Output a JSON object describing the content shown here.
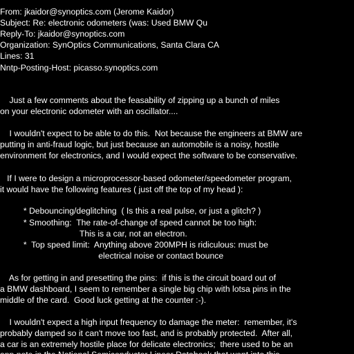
{
  "headers": {
    "from": "From: jkaidor@synoptics.com (Jerome Kaidor)",
    "subject": "Subject: Re: electronic odometers (was: Used BMW Qu",
    "reply_to": "Reply-To: jkaidor@synoptics.com",
    "organization": "Organization: SynOptics Communications, Santa Clara CA",
    "lines": "Lines: 31",
    "nntp_posting_host": "Nntp-Posting-Host: picasso.synoptics.com"
  },
  "body": {
    "p1": [
      "    Just a few comments about the feasability of zipping up a bunch of miles",
      "on your electronic odometer with an oscillator...."
    ],
    "p2": [
      "    I wouldn't expect to be able to do this.  Not because the engineers at BMW are",
      "putting in anti-fraud logic, but just because an automobile is a noisy, hostile",
      "environment for electronics, and I would expect the software to be conservative."
    ],
    "p3": [
      "   If I were to design a microprocessor-based odometer/speedometer program,",
      "it would have the following features ( just off the top of my head ):"
    ],
    "features": [
      "          * Debouncing/deglitching  ( Is this a real pulse, or just a glitch? )",
      "          * Smoothing:  The rate-of-change of speed cannot be too high:",
      "                                  This is a car, not an electron.",
      "          *  Top speed limit:  Anything above 200MPH is ridiculous: must be",
      "                                          electrical noise or contact bounce"
    ],
    "p4": [
      "    As for getting in and presetting the pins:  if this is the circuit board out of",
      "a BMW dashboard, I seem to remember a single big chip with lotsa pins in the",
      "middle of the card.  Good luck getting at the counter :-)."
    ],
    "p5": [
      "    I wouldn't expect a high input frequency to damage the meter:  remember, it's",
      "probably damped so it can't move too fast, and is probably protected.  After all,",
      "a car is an extremely hostile place for delicate electronics;  there used to be an",
      "app note in the National Semiconductor Linear Databook that went into this"
    ]
  }
}
